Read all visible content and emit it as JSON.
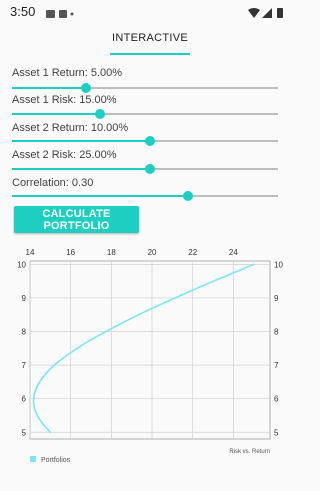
{
  "status_bar": {
    "time": "3:50"
  },
  "tabs": [
    {
      "label": "INTERACTIVE"
    }
  ],
  "controls": {
    "asset1_return": {
      "label": "Asset 1 Return: 5.00%",
      "value": 0.28
    },
    "asset1_risk": {
      "label": "Asset 1 Risk: 15.00%",
      "value": 0.33
    },
    "asset2_return": {
      "label": "Asset 2 Return: 10.00%",
      "value": 0.52
    },
    "asset2_risk": {
      "label": "Asset 2 Risk: 25.00%",
      "value": 0.52
    },
    "correlation": {
      "label": "Correlation: 0.30",
      "value": 0.66
    }
  },
  "calculate_button": {
    "label": "CALCULATE PORTFOLIO"
  },
  "chart_data": {
    "type": "scatter",
    "xlabel": "",
    "ylabel": "",
    "corner_label": "Risk vs. Return",
    "xlim": [
      14,
      25.8
    ],
    "ylim": [
      4.8,
      10.1
    ],
    "x_ticks": [
      "14",
      "16",
      "18",
      "20",
      "22",
      "24"
    ],
    "y_ticks": [
      "5",
      "6",
      "7",
      "8",
      "9",
      "10"
    ],
    "grid": true,
    "legend": "bottom-left",
    "series": [
      {
        "name": "Portfolios",
        "color": "#7ee5f5",
        "x": [
          15.0,
          14.66,
          14.4,
          14.23,
          14.17,
          14.21,
          14.34,
          14.57,
          14.89,
          15.29,
          15.77,
          16.32,
          16.92,
          17.58,
          18.29,
          19.04,
          19.82,
          20.63,
          21.47,
          22.33,
          23.21,
          24.1,
          25.0
        ],
        "y": [
          5.0,
          5.23,
          5.45,
          5.68,
          5.91,
          6.14,
          6.36,
          6.59,
          6.82,
          7.05,
          7.27,
          7.5,
          7.73,
          7.95,
          8.18,
          8.41,
          8.64,
          8.86,
          9.09,
          9.32,
          9.55,
          9.77,
          10.0
        ]
      }
    ]
  }
}
